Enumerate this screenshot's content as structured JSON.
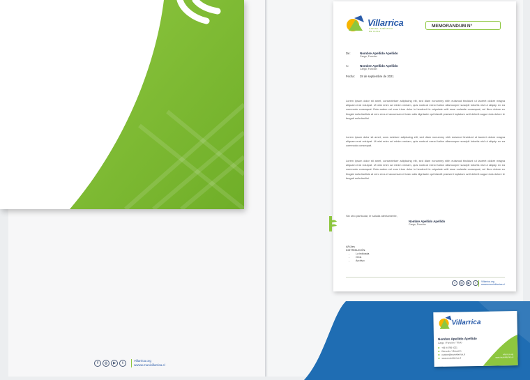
{
  "colors": {
    "green": "#8dc63f",
    "blue": "#1f6db3",
    "navy": "#1e2a44"
  },
  "brand": {
    "name": "Villarrica",
    "tagline": "CAPITAL TURÍSTICO DE CHILE"
  },
  "memo": {
    "title": "MEMORANDUM  N°",
    "de_label": "De:",
    "de_name": "Nombre Apellido Apellido",
    "de_role": "Cargo, Función",
    "a_label": "A:",
    "a_name": "Nombre Apellido Apellido",
    "a_role": "Cargo, Función",
    "fecha_label": "Fecha:",
    "fecha_value": "28 de septiembre de 2021",
    "p1": "Lorem ipsum dolor sit amet, consectetuer adipiscing elit, sed diam nonummy nibh euismod tincidunt ut laoreet dolore magna aliquam erat volutpat. Ut wisi enim ad minim veniam, quis nostrud exerci tation ullamcorper suscipit lobortis nisl ut aliquip ex ea commodo consequat. Duis autem vel eum iriure dolor in hendrerit in vulputate velit esse molestie consequat, vel illum dolore eu feugiat nulla facilisis at vero eros et accumsan et iusto odio dignissim qui blandit praesent luptatum zzril delenit augue duis dolore te feugait nulla facilisi.",
    "p2": "Lorem ipsum dolor sit amet, cons ectetuer adipiscing elit, sed diam nonummy nibh euismod tincidunt ut laoreet dolore magna aliquam erat volutpat. Ut wisi enim ad minim veniam, quis nostrud exerci tation ullamcorper suscipit lobortis nisl ut aliquip ex ea commodo consequat.",
    "p3": "Lorem ipsum dolor sit amet, consectetuer adipiscing elit, sed diam nonummy nibh euismod tincidunt ut laoreet dolore magna aliquam erat volutpat. Ut wisi enim ad minim veniam, quis nostrud exerci tation ullamcorper suscipit lobortis nisl ut aliquip ex ea commodo consequat. Duis autem vel eum iriure dolor in hendrerit in vulputate velit esse molestie consequat, vel illum dolore eu feugiat nulla facilisis at vero eros et accumsan et iusto odio dignissim qui blandit praesent luptatum zzril delenit augue duis dolore te feugait nulla facilisi.",
    "closing": "Sin otro particular, le saluda atentamente,",
    "sign_name": "Nombre Apellido Apellido",
    "sign_role": "Cargo, Función",
    "initials": "AR/Aes",
    "distribucion_label": "DISTRIBUCIÓN:",
    "distribucion": [
      "La indicada",
      "OCA",
      "Archivo"
    ]
  },
  "footer": {
    "web1": "Villarrica.org",
    "web2": "wwww.munivillarrica.cl",
    "social_icons": [
      "facebook-icon",
      "instagram-icon",
      "youtube-icon",
      "twitter-icon"
    ]
  },
  "card": {
    "name": "Nombre Apellido Apellido",
    "role": "Cargo / Función / Título",
    "lines": [
      "+56 9 8765 4321",
      "Dirección / Ubicación",
      "nombre@munivillarrica.cl",
      "www.munivillarrica.cl"
    ],
    "web1": "villarrica.org",
    "web2": "www.munivillarrica.cl"
  }
}
